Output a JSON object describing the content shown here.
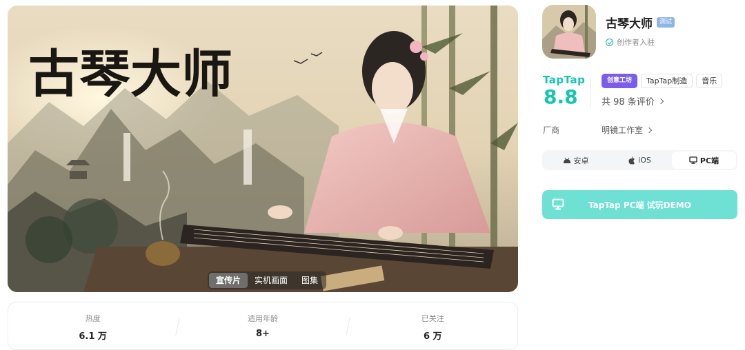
{
  "media": {
    "tabs": [
      {
        "label": "宣传片",
        "active": true
      },
      {
        "label": "实机画面",
        "active": false
      },
      {
        "label": "图集",
        "active": false
      }
    ],
    "artwork_title": "古琴大师"
  },
  "stats": [
    {
      "label": "热度",
      "value": "6.1 万"
    },
    {
      "label": "适用年龄",
      "value": "8+"
    },
    {
      "label": "已关注",
      "value": "6 万"
    }
  ],
  "app": {
    "name": "古琴大师",
    "badge": "测试",
    "creator": "创作者入驻",
    "score_brand": "TapTap",
    "score": "8.8",
    "tags": [
      "创意工坊",
      "TapTap制造",
      "音乐"
    ],
    "reviews": "共 98 条评价",
    "vendor_label": "厂商",
    "vendor_value": "明镜工作室"
  },
  "platforms": [
    {
      "label": "安卓",
      "icon": "android-icon",
      "active": false
    },
    {
      "label": "iOS",
      "icon": "apple-icon",
      "active": false
    },
    {
      "label": "PC端",
      "icon": "monitor-icon",
      "active": true
    }
  ],
  "demo_button": {
    "label": "TapTap PC端 试玩DEMO",
    "icon": "monitor-icon"
  },
  "colors": {
    "accent": "#15c5b3",
    "button": "#6ee0d4",
    "tag_primary": "#7b5de8"
  }
}
